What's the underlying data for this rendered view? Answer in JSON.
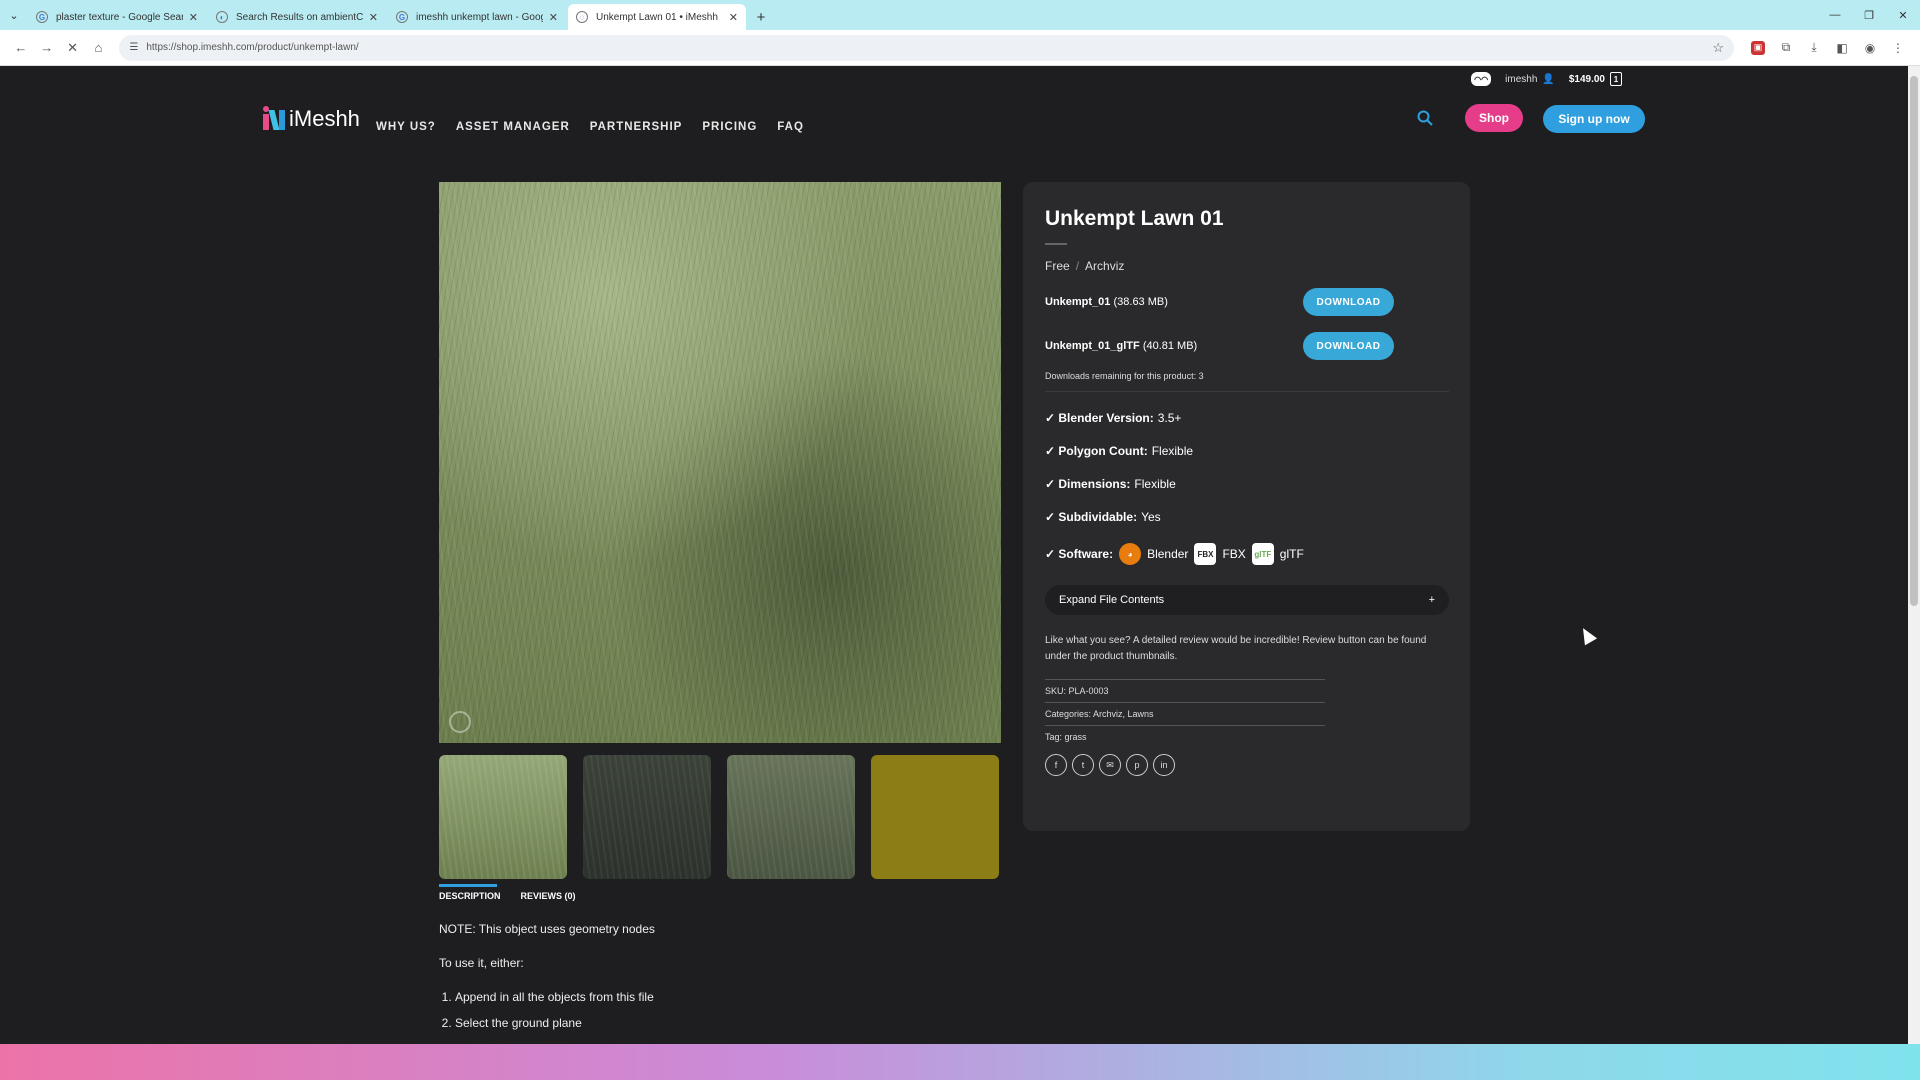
{
  "browser": {
    "tabs": [
      {
        "title": "plaster texture - Google Search",
        "icon": "G",
        "active": false
      },
      {
        "title": "Search Results on ambientCG",
        "icon": "A",
        "active": false
      },
      {
        "title": "imeshh unkempt lawn - Google",
        "icon": "G",
        "active": false
      },
      {
        "title": "Unkempt Lawn 01 • iMeshh",
        "icon": "i",
        "active": true
      }
    ],
    "url": "https://shop.imeshh.com/product/unkempt-lawn/"
  },
  "site": {
    "logo_text": "iMeshh",
    "nav": [
      "WHY US?",
      "ASSET MANAGER",
      "PARTNERSHIP",
      "PRICING",
      "FAQ"
    ],
    "user": "imeshh",
    "cart_total": "$149.00",
    "cart_count": "1",
    "shop_label": "Shop",
    "signup_label": "Sign up now"
  },
  "product": {
    "title": "Unkempt Lawn 01",
    "crumbs": [
      "Free",
      "Archviz"
    ],
    "downloads": [
      {
        "name": "Unkempt_01",
        "size": "(38.63 MB)",
        "button": "DOWNLOAD"
      },
      {
        "name": "Unkempt_01_glTF",
        "size": "(40.81 MB)",
        "button": "DOWNLOAD"
      }
    ],
    "remaining": "Downloads remaining for this product: 3",
    "specs": [
      {
        "label": "✓ Blender Version:",
        "value": "3.5+"
      },
      {
        "label": "✓ Polygon Count:",
        "value": "Flexible"
      },
      {
        "label": "✓ Dimensions:",
        "value": "Flexible"
      },
      {
        "label": "✓ Subdividable:",
        "value": "Yes"
      }
    ],
    "software_label": "✓ Software:",
    "software": [
      {
        "icon": "blender-icon",
        "name": "Blender"
      },
      {
        "icon": "fbx-icon",
        "name": "FBX"
      },
      {
        "icon": "gltf-icon",
        "name": "glTF"
      }
    ],
    "expand_label": "Expand File Contents",
    "review_note": "Like what you see? A detailed review would be incredible! Review button can be found under the product thumbnails.",
    "sku": "SKU: PLA-0003",
    "categories": "Categories: Archviz, Lawns",
    "tag": "Tag: grass"
  },
  "tabs": {
    "description": "DESCRIPTION",
    "reviews": "REVIEWS (0)"
  },
  "description": {
    "note": "NOTE: This object uses geometry nodes",
    "intro": "To use it, either:",
    "steps": [
      "Append in all the objects from this file",
      "Select the ground plane"
    ]
  },
  "colors": {
    "shop": "#e63d8a",
    "signup": "#2f9fe0",
    "download": "#37a8d8"
  }
}
